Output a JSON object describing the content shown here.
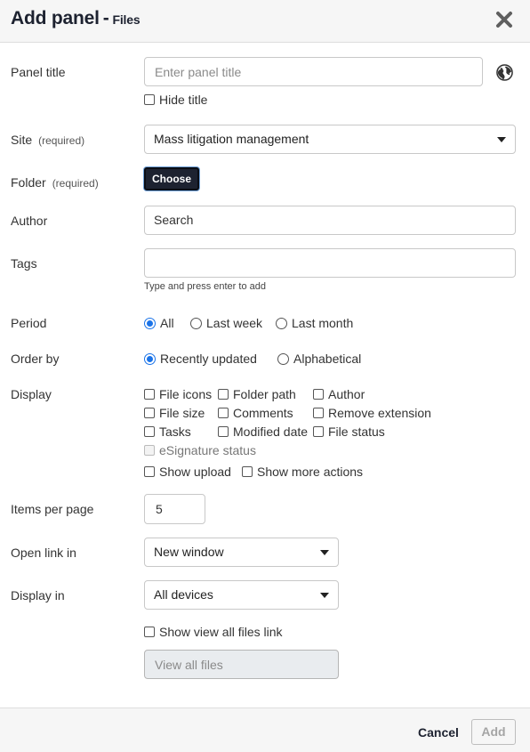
{
  "header": {
    "title": "Add panel",
    "separator": "-",
    "subtitle": "Files"
  },
  "close": {
    "icon": "close-icon"
  },
  "fields": {
    "panel_title": {
      "label": "Panel title",
      "placeholder": "Enter panel title",
      "value": "",
      "globe_icon": "globe-icon"
    },
    "hide_title": {
      "label": "Hide title",
      "checked": false
    },
    "site": {
      "label": "Site",
      "required": "(required)",
      "value": "Mass litigation management"
    },
    "folder": {
      "label": "Folder",
      "required": "(required)",
      "button": "Choose"
    },
    "author": {
      "label": "Author",
      "value": "Search"
    },
    "tags": {
      "label": "Tags",
      "value": "",
      "hint": "Type and press enter to add"
    },
    "period": {
      "label": "Period",
      "options": [
        "All",
        "Last week",
        "Last month"
      ],
      "selected": "All"
    },
    "order_by": {
      "label": "Order by",
      "options": [
        "Recently updated",
        "Alphabetical"
      ],
      "selected": "Recently updated"
    },
    "display": {
      "label": "Display",
      "options": [
        "File icons",
        "Folder path",
        "Author",
        "File size",
        "Comments",
        "Remove extension",
        "Tasks",
        "Modified date",
        "File status",
        "eSignature status",
        "Show upload",
        "Show more actions"
      ]
    },
    "items_per_page": {
      "label": "Items per page",
      "value": "5"
    },
    "open_link_in": {
      "label": "Open link in",
      "value": "New window"
    },
    "display_in": {
      "label": "Display in",
      "value": "All devices"
    },
    "show_view_all": {
      "label": "Show view all files link",
      "checked": false
    },
    "view_all_text": {
      "value": "View all files"
    }
  },
  "footer": {
    "cancel": "Cancel",
    "add": "Add"
  },
  "colors": {
    "accent": "#1a73e8",
    "dark": "#1d2230",
    "header_bg": "#f6f6f6"
  }
}
